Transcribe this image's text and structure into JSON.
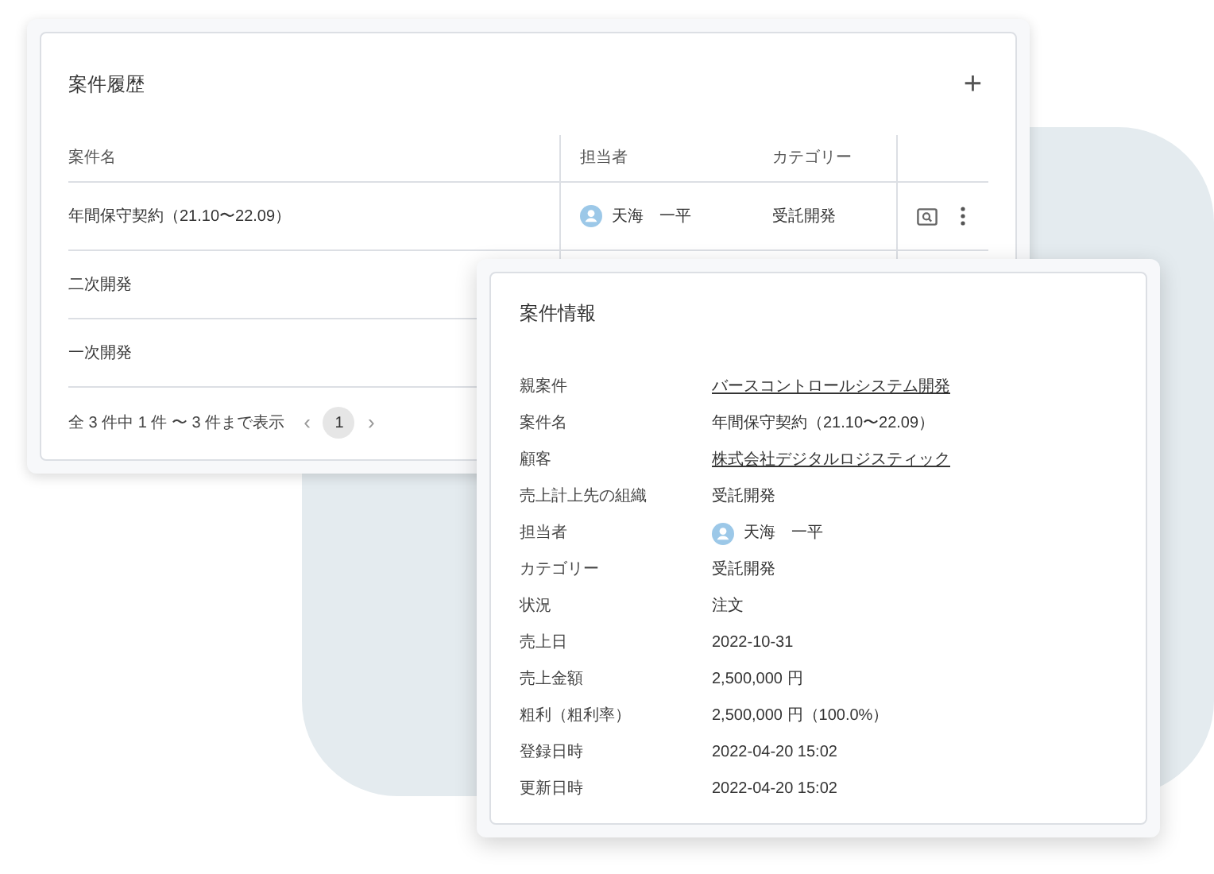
{
  "history": {
    "title": "案件履歴",
    "add_button": "+",
    "columns": [
      "案件名",
      "担当者",
      "カテゴリー"
    ],
    "rows": [
      {
        "name": "年間保守契約（21.10〜22.09）",
        "assignee": "天海　一平",
        "category": "受託開発"
      },
      {
        "name": "二次開発"
      },
      {
        "name": "一次開発"
      }
    ],
    "footer": {
      "summary": "全 3 件中 1 件 〜 3 件まで表示",
      "prev": "‹",
      "next": "›",
      "pages": [
        {
          "label": "1",
          "selected": true
        }
      ]
    }
  },
  "details": {
    "title": "案件情報",
    "fields": [
      {
        "label": "親案件",
        "value": "バースコントロールシステム開発",
        "kind": "link"
      },
      {
        "label": "案件名",
        "value": "年間保守契約（21.10〜22.09）",
        "kind": "text"
      },
      {
        "label": "顧客",
        "value": "株式会社デジタルロジスティック",
        "kind": "link"
      },
      {
        "label": "売上計上先の組織",
        "value": "受託開発",
        "kind": "text"
      },
      {
        "label": "担当者",
        "value": "天海　一平",
        "kind": "person"
      },
      {
        "label": "カテゴリー",
        "value": "受託開発",
        "kind": "text"
      },
      {
        "label": "状況",
        "value": "注文",
        "kind": "text"
      },
      {
        "label": "売上日",
        "value": "2022-10-31",
        "kind": "text"
      },
      {
        "label": "売上金額",
        "value": "2,500,000 円",
        "kind": "text"
      },
      {
        "label": "粗利（粗利率）",
        "value": "2,500,000 円（100.0%）",
        "kind": "text"
      },
      {
        "label": "登録日時",
        "value": "2022-04-20 15:02",
        "kind": "text"
      },
      {
        "label": "更新日時",
        "value": "2022-04-20 15:02",
        "kind": "text"
      }
    ]
  }
}
